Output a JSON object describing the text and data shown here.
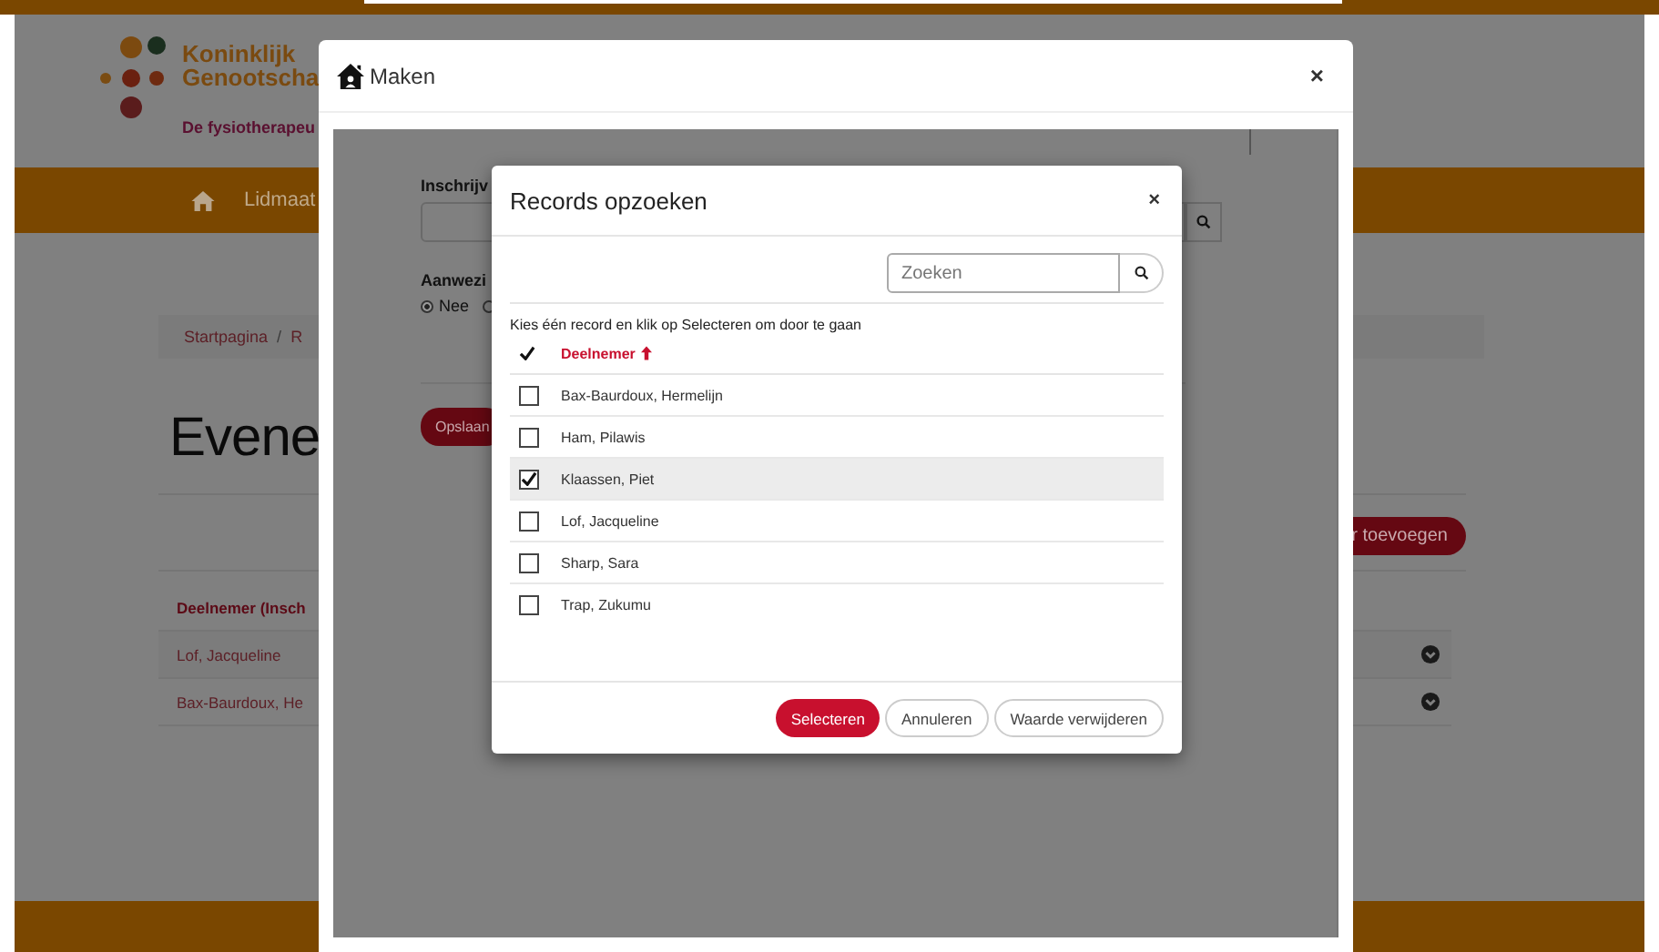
{
  "background_page": {
    "logo": {
      "line_1": "Koninklijk",
      "line_2": "Genootscha",
      "tagline": "De fysiotherapeu"
    },
    "nav": {
      "items": [
        "Lidmaat"
      ]
    },
    "breadcrumb": [
      "Startpagina",
      "/",
      "R"
    ],
    "heading": "Evene",
    "add_button": "r toevoegen",
    "table": {
      "column": "Deelnemer (Insch",
      "rows": [
        "Lof, Jacqueline",
        "Bax-Baurdoux, He"
      ]
    }
  },
  "dialog": {
    "title": "Maken",
    "close": "×",
    "form": {
      "lookup_label": "Inschrijv",
      "radio_label": "Aanwezi",
      "options": [
        {
          "label": "Nee",
          "selected": true
        },
        {
          "selected": false
        }
      ],
      "save_button": "Opslaan"
    },
    "lookup": {
      "title": "Records opzoeken",
      "close": "×",
      "search": {
        "placeholder": "Zoeken"
      },
      "instruction": "Kies één record en klik op Selecteren om door te gaan",
      "column": "Deelnemer",
      "rows": [
        {
          "name": "Bax-Baurdoux, Hermelijn",
          "selected": false
        },
        {
          "name": "Ham, Pilawis",
          "selected": false
        },
        {
          "name": "Klaassen, Piet",
          "selected": true
        },
        {
          "name": "Lof, Jacqueline",
          "selected": false
        },
        {
          "name": "Sharp, Sara",
          "selected": false
        },
        {
          "name": "Trap, Zukumu",
          "selected": false
        }
      ],
      "buttons": [
        {
          "label": "Selecteren",
          "kind": "primary"
        },
        {
          "label": "Annuleren",
          "kind": "secondary"
        },
        {
          "label": "Waarde verwijderen",
          "kind": "secondary"
        }
      ]
    }
  }
}
